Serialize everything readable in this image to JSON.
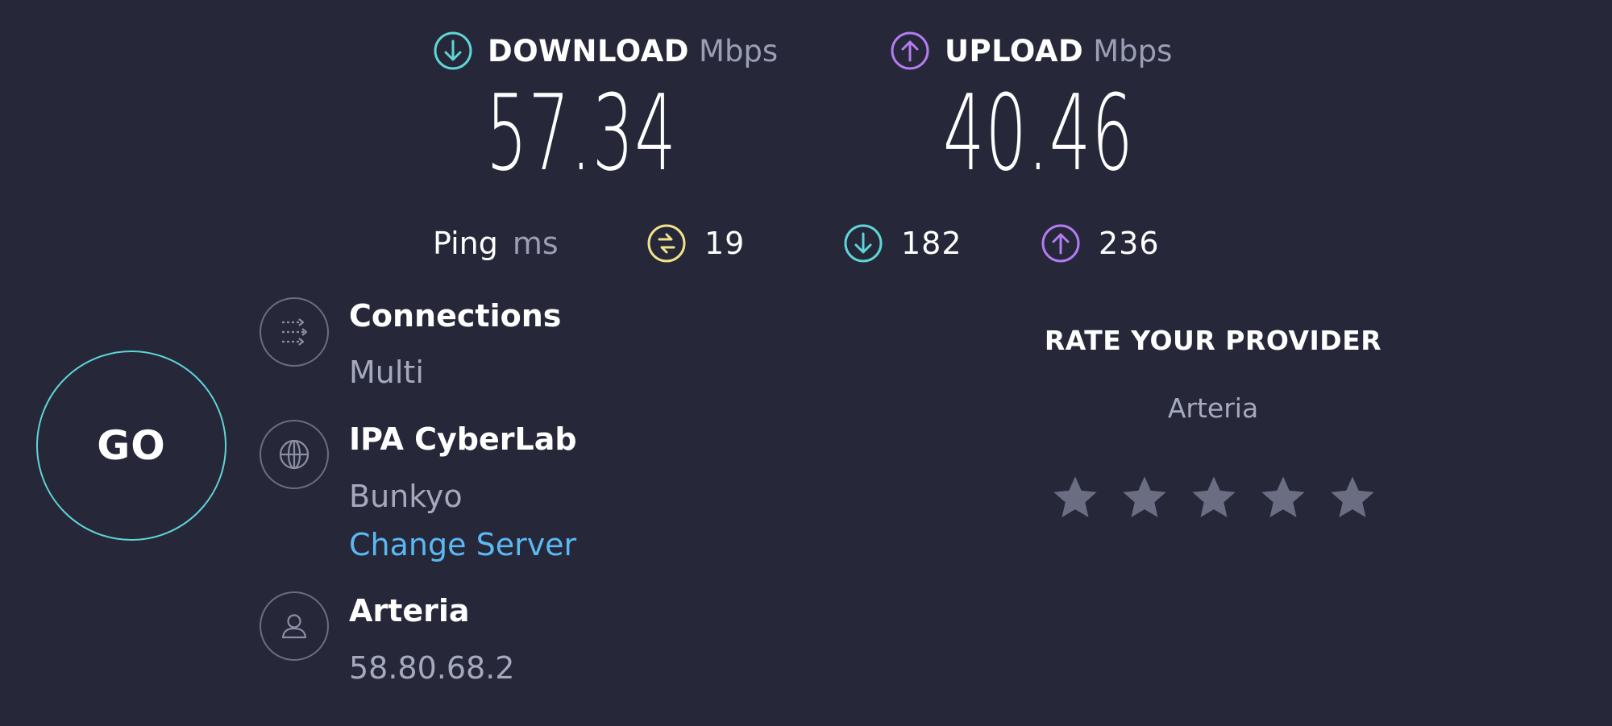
{
  "results": {
    "download": {
      "label": "DOWNLOAD",
      "unit": "Mbps",
      "value": "57.34",
      "icon": "arrow-down-circle-icon",
      "color": "#5fd5d6"
    },
    "upload": {
      "label": "UPLOAD",
      "unit": "Mbps",
      "value": "40.46",
      "icon": "arrow-up-circle-icon",
      "color": "#b47cf0"
    }
  },
  "ping": {
    "label": "Ping",
    "unit": "ms",
    "idle": {
      "value": "19",
      "icon": "ping-jitter-icon",
      "color": "#f2e28a"
    },
    "download": {
      "value": "182",
      "icon": "arrow-down-circle-icon",
      "color": "#5fd5d6"
    },
    "upload": {
      "value": "236",
      "icon": "arrow-up-circle-icon",
      "color": "#b47cf0"
    }
  },
  "go_button": {
    "label": "GO",
    "color": "#5fd5d6"
  },
  "connections": {
    "title": "Connections",
    "value": "Multi",
    "icon": "connections-icon"
  },
  "server": {
    "name": "IPA CyberLab",
    "location": "Bunkyo",
    "change_label": "Change Server",
    "icon": "globe-icon"
  },
  "provider": {
    "name": "Arteria",
    "ip": "58.80.68.2",
    "icon": "user-icon"
  },
  "rating": {
    "title": "RATE YOUR PROVIDER",
    "provider_name": "Arteria",
    "max_stars": 5,
    "rating": 0,
    "star_color": "#6b6e82"
  }
}
